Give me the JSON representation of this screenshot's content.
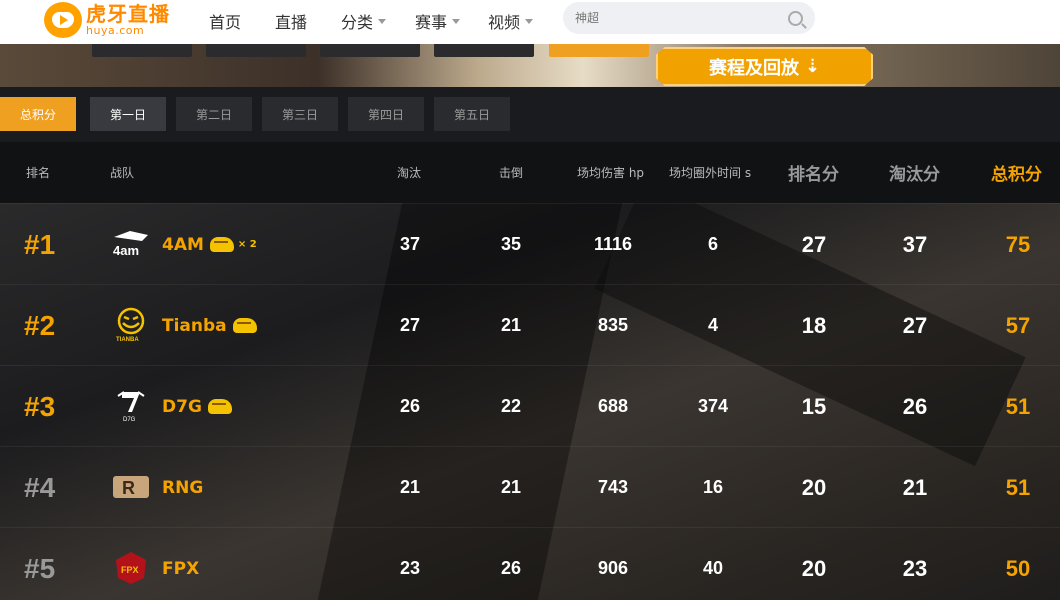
{
  "nav": {
    "logo_cn": "虎牙直播",
    "logo_en": "huya.com",
    "items": [
      {
        "label": "首页",
        "dropdown": false
      },
      {
        "label": "直播",
        "dropdown": false
      },
      {
        "label": "分类",
        "dropdown": true
      },
      {
        "label": "赛事",
        "dropdown": true
      },
      {
        "label": "视频",
        "dropdown": true
      }
    ],
    "search_placeholder": "神超"
  },
  "banner": {
    "replay_label": "赛程及回放"
  },
  "tabs": [
    "总积分",
    "第一日",
    "第二日",
    "第三日",
    "第四日",
    "第五日"
  ],
  "active_tab": "第一日",
  "table": {
    "headers": {
      "rank": "排名",
      "team": "战队",
      "eliminations": "淘汰",
      "knockdowns": "击倒",
      "avg_damage": "场均伤害 hp",
      "avg_outside_time": "场均圈外时间 s",
      "rank_points": "排名分",
      "elim_points": "淘汰分",
      "total_points": "总积分"
    },
    "rows": [
      {
        "rank": "#1",
        "team": "4AM",
        "logo_text": "4am",
        "chicken": true,
        "chicken_mult": "× 2",
        "eliminations": "37",
        "knockdowns": "35",
        "avg_damage": "1116",
        "avg_outside_time": "6",
        "rank_points": "27",
        "elim_points": "37",
        "total_points": "75"
      },
      {
        "rank": "#2",
        "team": "Tianba",
        "logo_text": "TIANBA",
        "chicken": true,
        "chicken_mult": "",
        "eliminations": "27",
        "knockdowns": "21",
        "avg_damage": "835",
        "avg_outside_time": "4",
        "rank_points": "18",
        "elim_points": "27",
        "total_points": "57"
      },
      {
        "rank": "#3",
        "team": "D7G",
        "logo_text": "D7G",
        "chicken": true,
        "chicken_mult": "",
        "eliminations": "26",
        "knockdowns": "22",
        "avg_damage": "688",
        "avg_outside_time": "374",
        "rank_points": "15",
        "elim_points": "26",
        "total_points": "51"
      },
      {
        "rank": "#4",
        "team": "RNG",
        "logo_text": "R",
        "chicken": false,
        "chicken_mult": "",
        "eliminations": "21",
        "knockdowns": "21",
        "avg_damage": "743",
        "avg_outside_time": "16",
        "rank_points": "20",
        "elim_points": "21",
        "total_points": "51"
      },
      {
        "rank": "#5",
        "team": "FPX",
        "logo_text": "FPX",
        "chicken": false,
        "chicken_mult": "",
        "eliminations": "23",
        "knockdowns": "26",
        "avg_damage": "906",
        "avg_outside_time": "40",
        "rank_points": "20",
        "elim_points": "23",
        "total_points": "50"
      }
    ]
  },
  "colors": {
    "accent": "#f4a300",
    "header_bg": "#111214",
    "nav_bg": "#ffffff"
  }
}
